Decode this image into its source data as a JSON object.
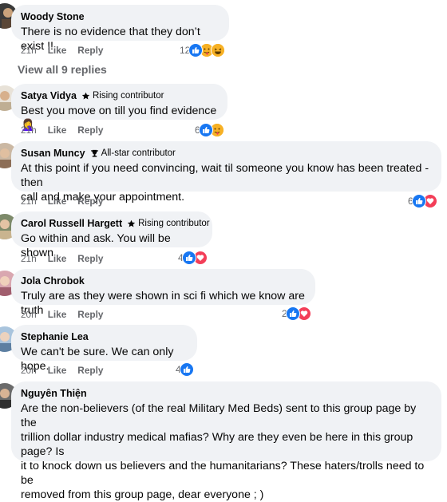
{
  "view_all_label": "View all 9 replies",
  "actions": {
    "like": "Like",
    "reply": "Reply"
  },
  "comments": [
    {
      "name": "Woody Stone",
      "badge": "",
      "text_lines": [
        "There is no evidence that they don’t exist !!"
      ],
      "time": "21h",
      "reaction_count": "12",
      "reactions": [
        "like",
        "care",
        "haha"
      ]
    },
    {
      "name": "Satya Vidya",
      "badge": "Rising contributor",
      "text_lines": [
        "Best you move on till you find evidence 🤦‍♀️"
      ],
      "time": "21h",
      "reaction_count": "6",
      "reactions": [
        "like",
        "care"
      ]
    },
    {
      "name": "Susan Muncy",
      "badge": "All-star contributor",
      "text_lines": [
        "At this point if you need convincing, wait til someone you know has been treated - then",
        "call and make your appointment."
      ],
      "time": "21h",
      "reaction_count": "6",
      "reactions": [
        "like",
        "love"
      ]
    },
    {
      "name": "Carol Russell Hargett",
      "badge": "Rising contributor",
      "text_lines": [
        "Go within and ask. You will be shown"
      ],
      "time": "21h",
      "reaction_count": "4",
      "reactions": [
        "like",
        "love"
      ]
    },
    {
      "name": "Jola Chrobok",
      "badge": "",
      "text_lines": [
        "Truly are as they were shown in sci fi which we know are truth"
      ],
      "time": "20h",
      "reaction_count": "2",
      "reactions": [
        "like",
        "love"
      ]
    },
    {
      "name": "Stephanie Lea",
      "badge": "",
      "text_lines": [
        "We can't be sure. We can only hope."
      ],
      "time": "20h",
      "reaction_count": "4",
      "reactions": [
        "like"
      ]
    },
    {
      "name": "Nguyên Thiện",
      "badge": "",
      "text_lines": [
        "Are the non-believers (of the real Military Med Beds) sent to this group page by the",
        "trillion dollar industry medical mafias? Why are they even be here in this group page? Is",
        "it to knock down us believers and the humanitarians? These haters/trolls need to be",
        "removed from this group page, dear everyone ; )"
      ],
      "time": "",
      "reaction_count": "",
      "reactions": []
    }
  ]
}
